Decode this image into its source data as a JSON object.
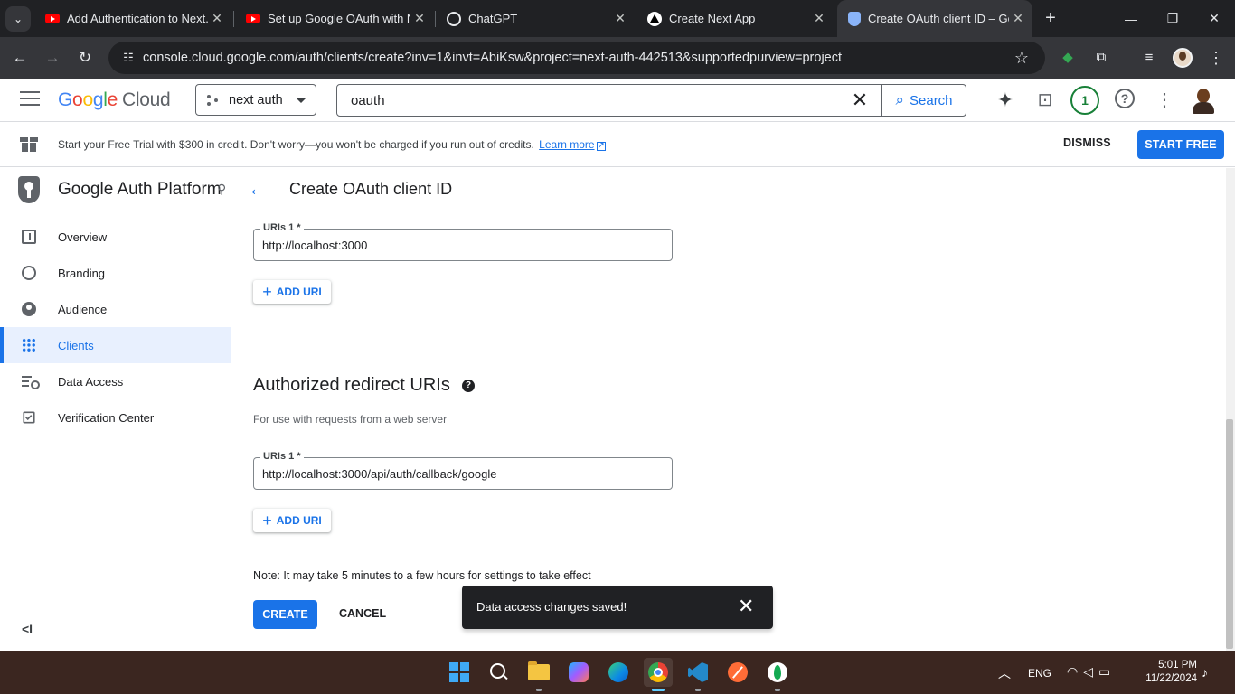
{
  "browser": {
    "tabs": [
      {
        "title": "Add Authentication to Next.js",
        "favicon": "youtube-icon",
        "active": false
      },
      {
        "title": "Set up Google OAuth with Next",
        "favicon": "youtube-icon",
        "active": false
      },
      {
        "title": "ChatGPT",
        "favicon": "chatgpt-icon",
        "active": false
      },
      {
        "title": "Create Next App",
        "favicon": "nextjs-icon",
        "active": false
      },
      {
        "title": "Create OAuth client ID – Goo",
        "favicon": "shield-icon",
        "active": true
      }
    ],
    "url": "console.cloud.google.com/auth/clients/create?inv=1&invt=AbiKsw&project=next-auth-442513&supportedpurview=project"
  },
  "console_header": {
    "logo_google": [
      "G",
      "o",
      "o",
      "g",
      "l",
      "e"
    ],
    "logo_cloud": "Cloud",
    "project_name": "next auth",
    "search_query": "oauth",
    "search_button": "Search",
    "notification_count": "1",
    "help_glyph": "?"
  },
  "trial_banner": {
    "text": "Start your Free Trial with $300 in credit. Don't worry—you won't be charged if you run out of credits.",
    "link": "Learn more",
    "dismiss": "DISMISS",
    "start": "START FREE"
  },
  "sidenav": {
    "title": "Google Auth Platform",
    "items": [
      {
        "label": "Overview",
        "icon": "dashboard-icon"
      },
      {
        "label": "Branding",
        "icon": "palette-icon"
      },
      {
        "label": "Audience",
        "icon": "person-icon"
      },
      {
        "label": "Clients",
        "icon": "apps-grid-icon",
        "active": true
      },
      {
        "label": "Data Access",
        "icon": "data-settings-icon"
      },
      {
        "label": "Verification Center",
        "icon": "verified-check-icon"
      }
    ],
    "collapse": "<I"
  },
  "main": {
    "title": "Create OAuth client ID",
    "origins": {
      "uri_label": "URIs 1 *",
      "uri_value": "http://localhost:3000",
      "add_uri": "ADD URI"
    },
    "redirect": {
      "heading": "Authorized redirect URIs",
      "subtext": "For use with requests from a web server",
      "uri_label": "URIs 1 *",
      "uri_value": "http://localhost:3000/api/auth/callback/google",
      "add_uri": "ADD URI"
    },
    "note": "Note: It may take 5 minutes to a few hours for settings to take effect",
    "create": "CREATE",
    "cancel": "CANCEL",
    "snackbar": "Data access changes saved!"
  },
  "taskbar": {
    "lang": "ENG",
    "time": "5:01 PM",
    "date": "11/22/2024"
  },
  "colors": {
    "accent": "#1a73e8",
    "active_nav_bg": "#e8f0fe",
    "snackbar_bg": "#202124",
    "taskbar_bg": "#3b2620"
  }
}
